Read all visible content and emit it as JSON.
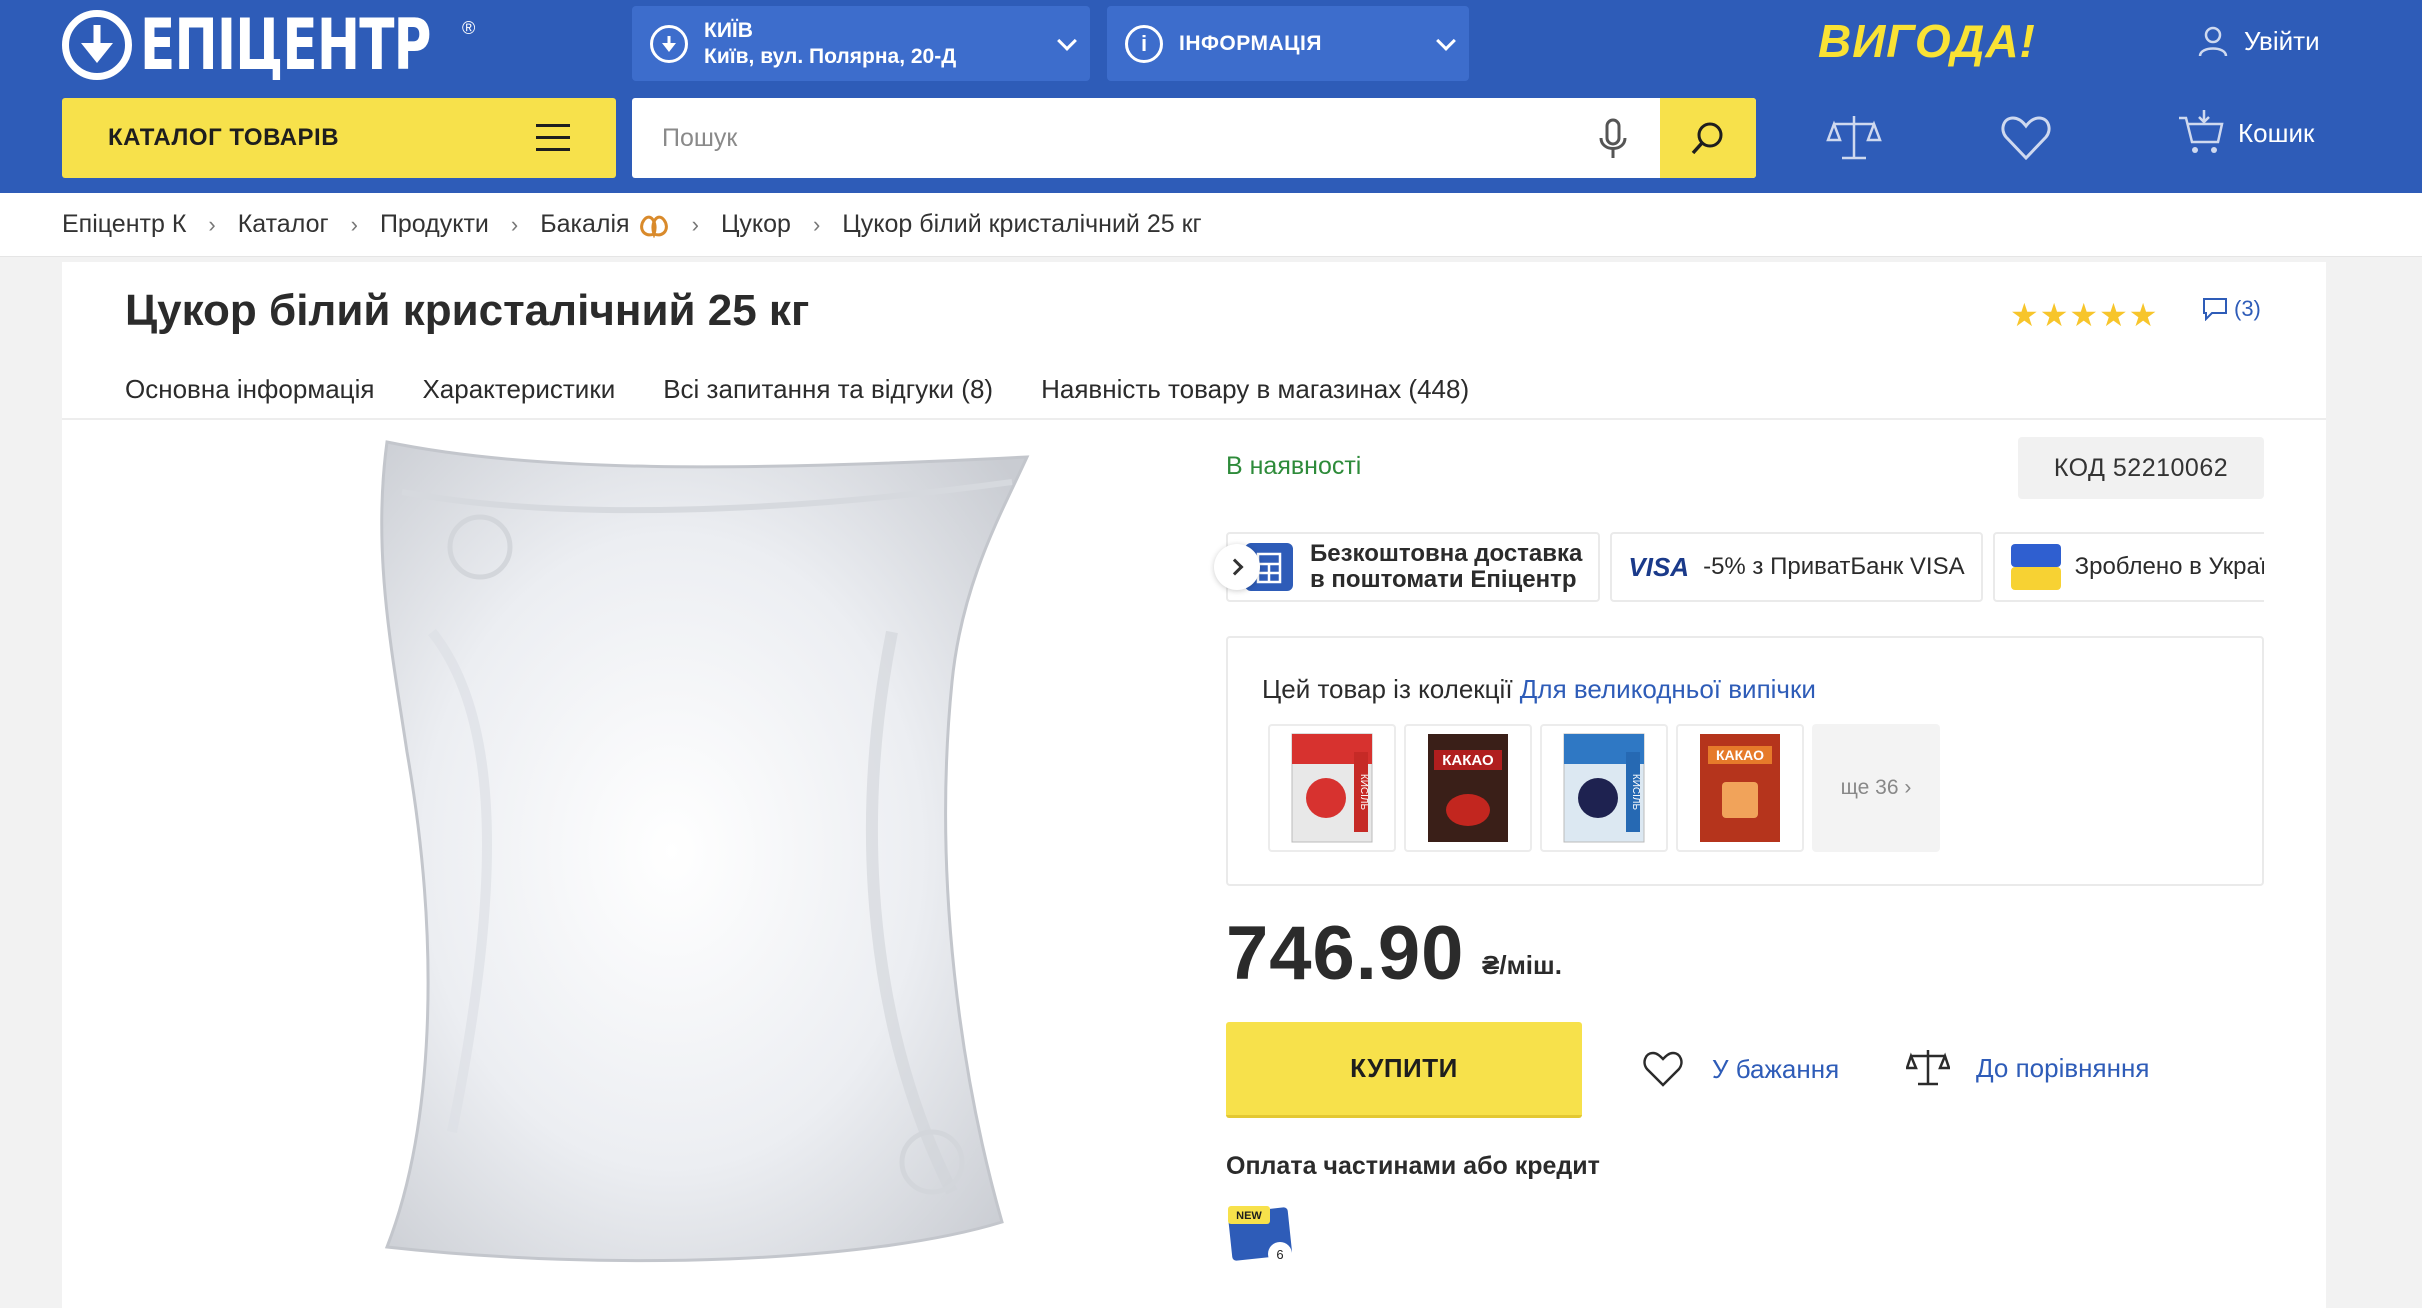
{
  "header": {
    "logo_text": "ЕПІЦЕНТР",
    "logo_reg": "®",
    "city_name": "КИЇВ",
    "city_address": "Київ, вул. Полярна, 20-Д",
    "info_label": "ІНФОРМАЦІЯ",
    "vygoda": "ВИГОДА!",
    "login_label": "Увійти",
    "catalog_label": "КАТАЛОГ ТОВАРІВ",
    "search_placeholder": "Пошук",
    "cart_label": "Кошик",
    "brand_color": "#2e5cb8",
    "accent_color": "#f7e14b"
  },
  "breadcrumbs": [
    {
      "label": "Епіцентр К"
    },
    {
      "label": "Каталог"
    },
    {
      "label": "Продукти"
    },
    {
      "label": "Бакалія"
    },
    {
      "label": "Цукор"
    },
    {
      "label": "Цукор білий кристалічний 25 кг"
    }
  ],
  "product": {
    "title": "Цукор білий кристалічний 25 кг",
    "rating_stars": 5,
    "reviews_count": "(3)",
    "tabs": [
      "Основна інформація",
      "Характеристики",
      "Всі запитання та відгуки (8)",
      "Наявність товару в магазинах (448)"
    ],
    "stock": "В наявності",
    "code": "КОД 52210062",
    "promos": {
      "delivery_line1": "Безкоштовна доставка",
      "delivery_line2": "в поштомати Епіцентр",
      "visa_logo": "VISA",
      "visa_text": "-5% з ПриватБанк VISA",
      "made_text": "Зроблено в Україні"
    },
    "collection": {
      "prefix": "Цей товар із колекції",
      "link": "Для великодньої випічки",
      "more": "ще 36",
      "thumbs": [
        {
          "icon": "jelly-strawberry-pack",
          "text": "КИСІЛЬ"
        },
        {
          "icon": "cocoa-dark-pack",
          "text": "КАКАО"
        },
        {
          "icon": "jelly-blueberry-pack",
          "text": "КИСІЛЬ"
        },
        {
          "icon": "cocoa-red-pack",
          "text": "КАКАО"
        }
      ]
    },
    "price": "746.90",
    "unit": "₴/міш.",
    "buy_label": "КУПИТИ",
    "wishlist_label": "У бажання",
    "compare_label": "До порівняння",
    "credit_label": "Оплата частинами або кредит",
    "credit_badge": "NEW",
    "credit_count": "6"
  }
}
